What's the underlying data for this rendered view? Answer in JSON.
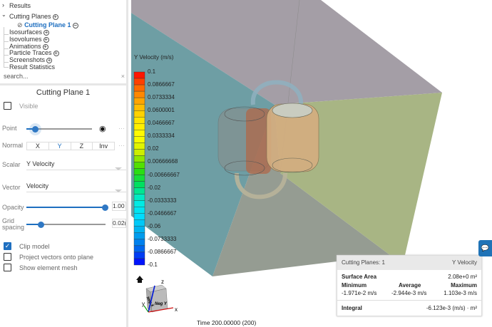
{
  "tree": {
    "items": [
      {
        "label": "Results",
        "expander": "chevron-right"
      },
      {
        "label": "Cutting Planes",
        "expander": "chevron-down",
        "action": "add"
      },
      {
        "label": "Cutting Plane 1",
        "action": "remove",
        "selected": true,
        "icon": "eye-slash"
      },
      {
        "label": "Isosurfaces",
        "action": "add"
      },
      {
        "label": "Isovolumes",
        "action": "add"
      },
      {
        "label": "Animations",
        "action": "add"
      },
      {
        "label": "Particle Traces",
        "action": "add"
      },
      {
        "label": "Screenshots",
        "action": "add"
      },
      {
        "label": "Result Statistics"
      }
    ],
    "search_placeholder": "search...",
    "clear": "×"
  },
  "panel": {
    "title": "Cutting Plane 1",
    "visible_label": "Visible",
    "visible": false,
    "point_label": "Point",
    "point_value": 0.1,
    "more": "···",
    "normal_label": "Normal",
    "normal_options": [
      "X",
      "Y",
      "Z",
      "Inv"
    ],
    "normal_selected": "Y",
    "scalar_label": "Scalar",
    "scalar_value": "Y Velocity",
    "vector_label": "Vector",
    "vector_value": "Velocity",
    "opacity_label": "Opacity",
    "opacity_value": "1.00",
    "opacity_fraction": 1.0,
    "grid_label1": "Grid",
    "grid_label2": "spacing",
    "grid_value": "0.02(",
    "grid_fraction": 0.18,
    "clip_label": "Clip model",
    "clip": true,
    "project_label": "Project vectors onto plane",
    "project": false,
    "mesh_label": "Show element mesh",
    "mesh": false
  },
  "colorbar": {
    "title": "Y Velocity (m/s)",
    "labels": [
      "0.1",
      "0.0866667",
      "0.0733334",
      "0.0600001",
      "0.0466667",
      "0.0333334",
      "0.02",
      "0.00666668",
      "-0.00666667",
      "-0.02",
      "-0.0333333",
      "-0.0466667",
      "-0.06",
      "-0.0733333",
      "-0.0866667",
      "-0.1"
    ],
    "segments": 30,
    "stops": [
      "#ff0000",
      "#ff6a00",
      "#ffb400",
      "#ffe600",
      "#ffff00",
      "#ccee00",
      "#33dd00",
      "#00e060",
      "#00eedd",
      "#00ddff",
      "#00aaee",
      "#0066ee",
      "#0000ff"
    ]
  },
  "stats": {
    "header_left": "Cutting Planes: 1",
    "header_right": "Y Velocity",
    "surface_area_label": "Surface Area",
    "surface_area": "2.08e+0 m²",
    "min_label": "Minimum",
    "avg_label": "Average",
    "max_label": "Maximum",
    "min": "-1.971e-2 m/s",
    "avg": "-2.944e-3 m/s",
    "max": "1.103e-3 m/s",
    "integral_label": "Integral",
    "integral": "-6.123e-3 (m/s) · m²"
  },
  "orientation": {
    "face_left": "Neg X",
    "face_right": "Neg Y",
    "axis_x": "x",
    "axis_y": "y",
    "axis_z": "z"
  },
  "time": "Time 200.00000 (200)",
  "colors": {
    "accent": "#1e6fc0",
    "chat": "#1f73b7"
  }
}
